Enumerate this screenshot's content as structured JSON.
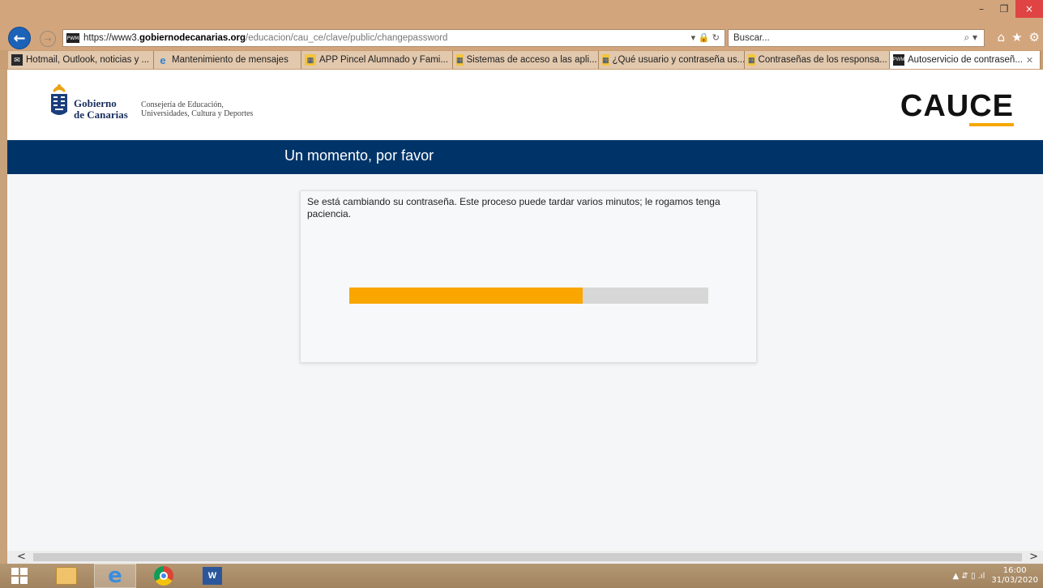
{
  "window": {
    "minimize": "–",
    "restore": "❐",
    "close": "×"
  },
  "nav": {
    "back_icon": "←",
    "forward_icon": "→",
    "url_scheme": "https://www3.",
    "url_domain": "gobiernodecanarias.org",
    "url_path": "/educacion/cau_ce/clave/public/changepassword",
    "addr_tools": "▾ 🔒 ↻",
    "search_placeholder": "Buscar...",
    "search_icon": "⌕ ▾",
    "home_icon": "⌂",
    "favorites_icon": "★",
    "settings_icon": "⚙"
  },
  "tabs": [
    {
      "label": "Hotmail, Outlook, noticias y ...",
      "icon": "hotmail-icon"
    },
    {
      "label": "Mantenimiento de mensajes",
      "icon": "ie-icon"
    },
    {
      "label": "APP Pincel Alumnado y Fami...",
      "icon": "gobierno-icon"
    },
    {
      "label": "Sistemas de acceso a las apli...",
      "icon": "gobierno-icon"
    },
    {
      "label": "¿Qué usuario y contraseña us...",
      "icon": "gobierno-icon"
    },
    {
      "label": "Contraseñas de los responsa...",
      "icon": "gobierno-icon"
    },
    {
      "label": "Autoservicio de contraseñ...",
      "icon": "pwm-icon",
      "active": true
    }
  ],
  "header": {
    "gc_line1": "Gobierno",
    "gc_line2": "de Canarias",
    "consejeria_line1": "Consejería de Educación,",
    "consejeria_line2": "Universidades, Cultura y Deportes",
    "cauce_prefix": "CAU",
    "cauce_suffix": "CE"
  },
  "main": {
    "title": "Un momento, por favor",
    "message": "Se está cambiando su contraseña. Este proceso puede tardar varios minutos; le rogamos tenga paciencia.",
    "progress": 0.65,
    "progress_color": "#f9a600"
  },
  "scroll": {
    "left": "<",
    "right": ">"
  },
  "taskbar": {
    "word_label": "W",
    "time": "16:00",
    "date": "31/03/2020",
    "tray_icons": "▲ ⇵ ▯ .ıl"
  }
}
